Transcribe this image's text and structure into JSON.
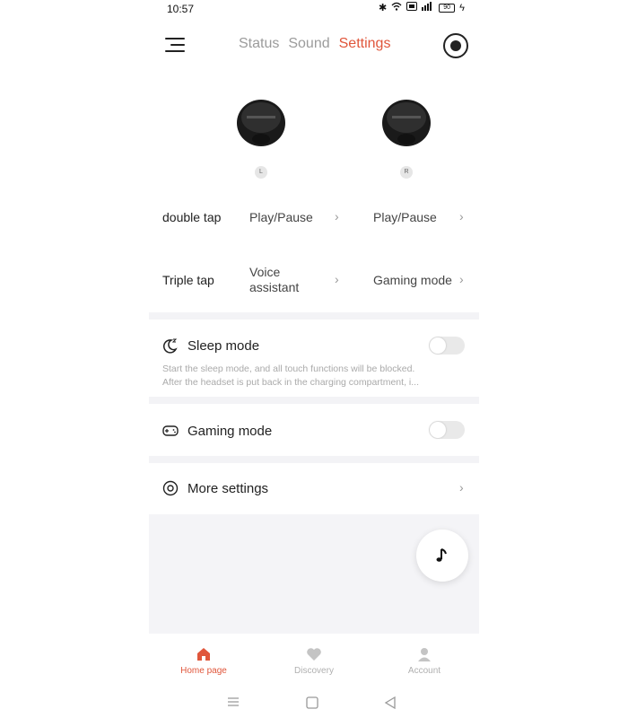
{
  "status_bar": {
    "time": "10:57",
    "battery": "90"
  },
  "tabs": [
    {
      "label": "Status"
    },
    {
      "label": "Sound"
    },
    {
      "label": "Settings"
    }
  ],
  "earbuds": {
    "left_label": "L",
    "right_label": "R"
  },
  "gestures": {
    "double_tap": {
      "title": "double tap",
      "left": "Play/Pause",
      "right": "Play/Pause"
    },
    "triple_tap": {
      "title": "Triple tap",
      "left_line1": "Voice",
      "left_line2": "assistant",
      "right": "Gaming mode"
    }
  },
  "sleep_mode": {
    "title": "Sleep mode",
    "enabled": false,
    "desc_line1": "Start the sleep mode, and all touch functions will be blocked.",
    "desc_line2": "After the headset is put back in the charging compartment, i..."
  },
  "gaming_mode": {
    "title": "Gaming mode",
    "enabled": false
  },
  "more_settings": {
    "title": "More settings"
  },
  "bottom_nav": [
    {
      "label": "Home page"
    },
    {
      "label": "Discovery"
    },
    {
      "label": "Account"
    }
  ],
  "colors": {
    "accent": "#e0563b",
    "inactive": "#b0b0b0"
  }
}
